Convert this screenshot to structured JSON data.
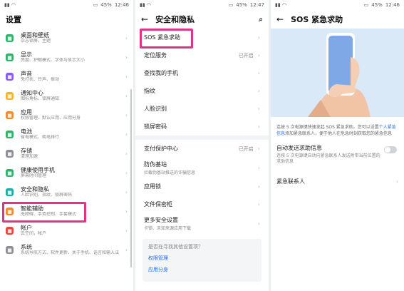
{
  "status": {
    "time1": "12:46",
    "time2": "12:47",
    "time3": "12:46",
    "battery": "45%"
  },
  "panel1": {
    "title": "设置",
    "items": [
      {
        "title": "桌面和壁纸",
        "sub": "杂志锁屏，主题",
        "color": "#2db66b"
      },
      {
        "title": "显示",
        "sub": "亮度、护眼模式、字体与显示大小",
        "color": "#2db66b"
      },
      {
        "title": "声音",
        "sub": "免打扰、铃声、振动",
        "color": "#8a5cf6"
      },
      {
        "title": "通知中心",
        "sub": "图标角标、锁屏通知",
        "color": "#f2b62b"
      },
      {
        "title": "应用",
        "sub": "权限管理、默认应用、应用分身",
        "color": "#f08a2c"
      },
      {
        "title": "电池",
        "sub": "省电模式、耗电排行",
        "color": "#2db66b"
      },
      {
        "title": "存储",
        "sub": "清理加速",
        "color": "#8c8f96"
      },
      {
        "title": "健康使用手机",
        "sub": "屏幕时间管理",
        "color": "#2db66b"
      },
      {
        "title": "安全和隐私",
        "sub": "人脸识别、指纹、锁屏密码",
        "color": "#1ab0a8"
      },
      {
        "title": "智能辅助",
        "sub": "无障碍、手势控制、手套模式",
        "color": "#f08a2c"
      },
      {
        "title": "帐户",
        "sub": "云空间，帐户",
        "color": "#e8463a"
      },
      {
        "title": "系统",
        "sub": "系统导航方式、软件更新、关于手机、语言和输入法",
        "color": "#8c8f96"
      }
    ]
  },
  "panel2": {
    "title": "安全和隐私",
    "items": [
      {
        "label": "SOS 紧急求助",
        "value": ""
      },
      {
        "label": "定位服务",
        "value": "已开启"
      },
      {
        "label": "查找我的手机",
        "value": ""
      },
      {
        "label": "指纹",
        "value": ""
      },
      {
        "label": "人脸识别",
        "value": ""
      },
      {
        "label": "锁屏密码",
        "value": ""
      }
    ],
    "items2": [
      {
        "label": "支付保护中心",
        "value": "已开启",
        "sub": ""
      },
      {
        "label": "防伪基站",
        "value": "",
        "sub": "拦截伪基站推送的诈骗信息"
      },
      {
        "label": "应用锁",
        "value": "",
        "sub": ""
      },
      {
        "label": "文件保密柜",
        "value": "",
        "sub": ""
      },
      {
        "label": "更多安全设置",
        "value": "",
        "sub": "卡锁、未知来源应用下载"
      }
    ],
    "suggest": {
      "question": "是否在寻找其他设置项？",
      "link1": "权限管理",
      "link2": "应用分身"
    }
  },
  "panel3": {
    "title": "SOS 紧急求助",
    "desc_a": "连按 5 次电源键快速发起 SOS 紧急求助。您可以设置",
    "desc_link": "个人紧急信息",
    "desc_b": "添加紧急联系人，便于他人在危急时刻获取您的紧急信息",
    "auto_title": "自动发送求助信息",
    "auto_sub": "连按 5 次电源键自动向紧急联系人发送附带当前位置的求助信息",
    "contacts": "紧急联系人"
  }
}
